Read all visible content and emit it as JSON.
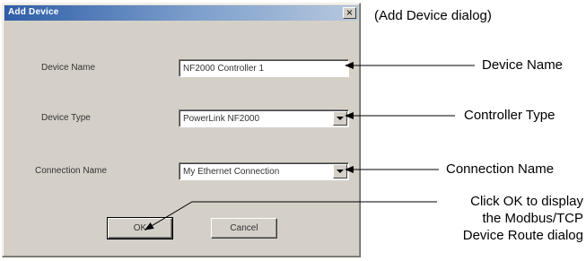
{
  "dialog": {
    "title": "Add Device",
    "close_label": "×",
    "device_name": {
      "label": "Device Name",
      "value": "NF2000 Controller 1"
    },
    "device_type": {
      "label": "Device Type",
      "value": "PowerLink NF2000"
    },
    "connection_name": {
      "label": "Connection Name",
      "value": "My Ethernet Connection"
    },
    "ok_label": "OK",
    "cancel_label": "Cancel"
  },
  "annotations": {
    "dialog_caption": "(Add Device dialog)",
    "device_name": "Device Name",
    "controller_type": "Controller Type",
    "connection_name": "Connection Name",
    "ok_hint_lines": [
      "Click OK to display",
      "the Modbus/TCP",
      "Device Route dialog"
    ]
  }
}
